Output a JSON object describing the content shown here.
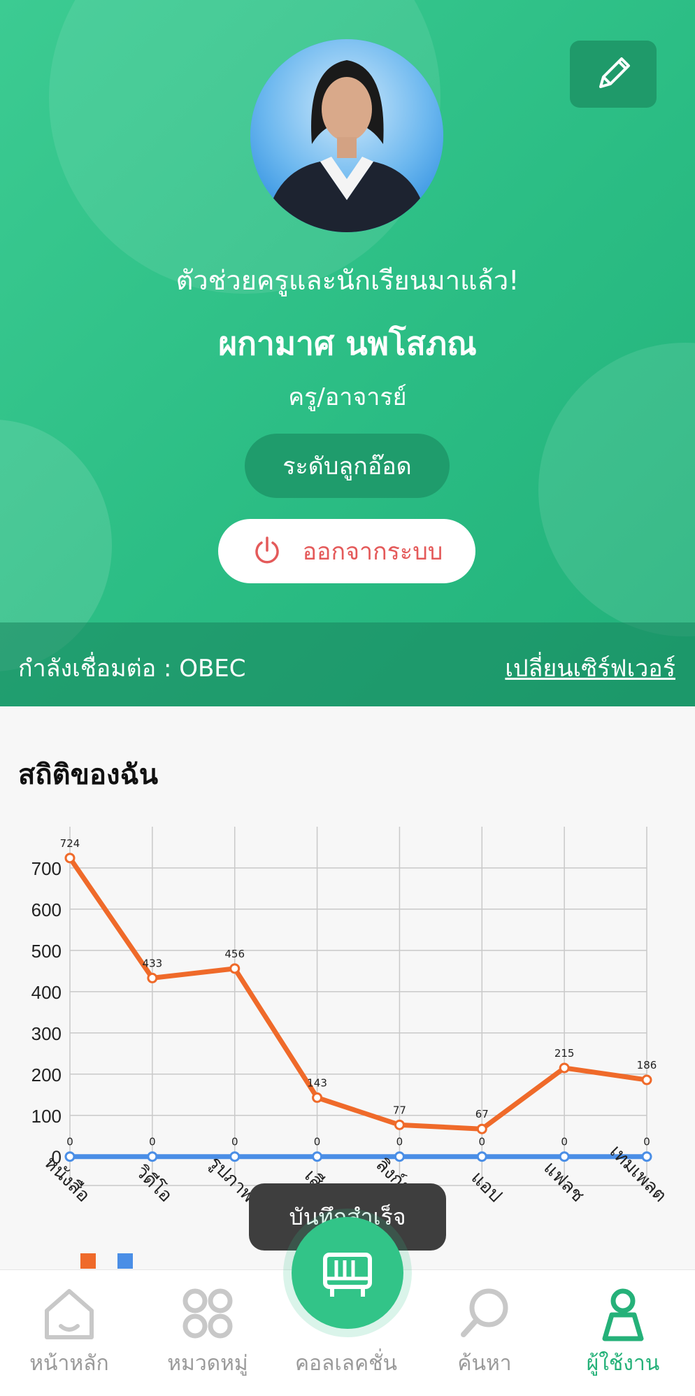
{
  "profile": {
    "greeting": "ตัวช่วยครูและนักเรียนมาแล้ว!",
    "name": "ผกามาศ นพโสภณ",
    "role": "ครู/อาจารย์",
    "level": "ระดับลูกอ๊อด",
    "logout_label": "ออกจากระบบ",
    "edit_icon": "pencil-icon"
  },
  "server": {
    "status": "กำลังเชื่อมต่อ : OBEC",
    "change_link": "เปลี่ยนเซิร์ฟเวอร์"
  },
  "stats": {
    "title": "สถิติของฉัน"
  },
  "toast": {
    "message": "บันทึกสำเร็จ"
  },
  "colors": {
    "brand": "#2bbd84",
    "series_1": "#ef6a2a",
    "series_2": "#4a8ee6",
    "logout": "#e45a5a"
  },
  "chart_data": {
    "type": "line",
    "categories": [
      "หนังสือ",
      "วิดีโอ",
      "รูปภาพ",
      "เสียง",
      "ลิงก์ย่อ",
      "แอป",
      "แฟลช",
      "เทมเพลต"
    ],
    "series": [
      {
        "values": [
          724,
          433,
          456,
          143,
          77,
          67,
          215,
          186
        ],
        "color": "#ef6a2a"
      },
      {
        "values": [
          0,
          0,
          0,
          0,
          0,
          0,
          0,
          0
        ],
        "color": "#4a8ee6"
      }
    ],
    "y_ticks": [
      0,
      100,
      200,
      300,
      400,
      500,
      600,
      700
    ],
    "ylim": [
      -70,
      800
    ],
    "grid": true,
    "legend": "bottom-left"
  },
  "bottom_nav": [
    {
      "label": "หน้าหลัก",
      "icon": "home-icon"
    },
    {
      "label": "หมวดหมู่",
      "icon": "category-grid-icon"
    },
    {
      "label": "คอลเลคชั่น",
      "icon": "collection-shelf-icon"
    },
    {
      "label": "ค้นหา",
      "icon": "search-icon"
    },
    {
      "label": "ผู้ใช้งาน",
      "icon": "user-icon",
      "active": true
    }
  ]
}
